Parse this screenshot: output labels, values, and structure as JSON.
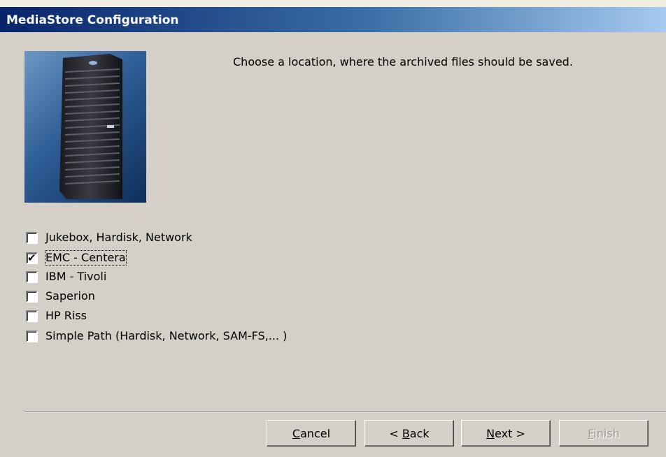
{
  "window": {
    "title": "MediaStore Configuration"
  },
  "instruction": "Choose a location, where the archived files should be saved.",
  "picture": {
    "icon": "server-tower-icon"
  },
  "options": [
    {
      "label": "Jukebox, Hardisk, Network",
      "checked": false
    },
    {
      "label": "EMC - Centera",
      "checked": true
    },
    {
      "label": "IBM - Tivoli",
      "checked": false
    },
    {
      "label": "Saperion",
      "checked": false
    },
    {
      "label": "HP Riss",
      "checked": false
    },
    {
      "label": "Simple Path (Hardisk, Network, SAM-FS,... )",
      "checked": false
    }
  ],
  "buttons": {
    "cancel": {
      "mnemonic": "C",
      "rest": "ancel",
      "enabled": true
    },
    "back": {
      "prefix": "< ",
      "mnemonic": "B",
      "rest": "ack",
      "enabled": true
    },
    "next": {
      "mnemonic": "N",
      "rest": "ext >",
      "enabled": true
    },
    "finish": {
      "mnemonic": "F",
      "rest": "inish",
      "enabled": false
    }
  },
  "colors": {
    "title_gradient_start": "#0a246a",
    "title_gradient_end": "#a6caf0",
    "dialog_background": "#d4d0c8"
  }
}
